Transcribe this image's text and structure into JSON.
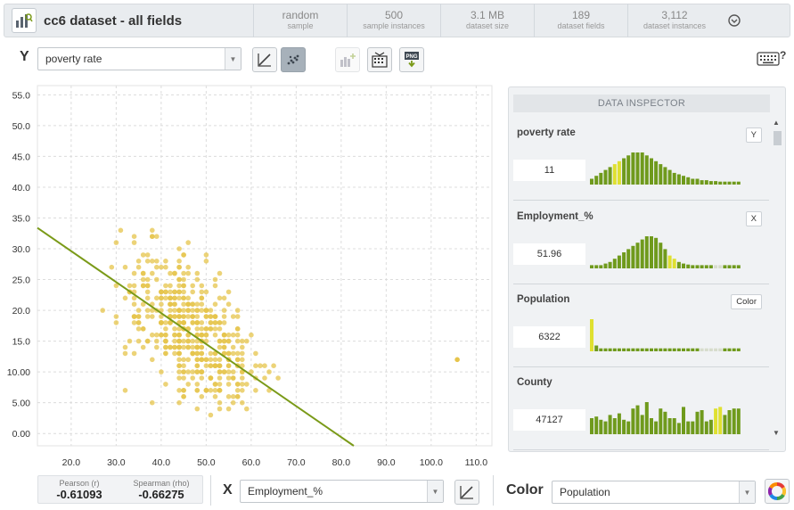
{
  "header": {
    "title": "cc6 dataset - all fields",
    "stats": [
      {
        "value": "random",
        "label": "sample"
      },
      {
        "value": "500",
        "label": "sample instances"
      },
      {
        "value": "3.1 MB",
        "label": "dataset size"
      },
      {
        "value": "189",
        "label": "dataset fields"
      },
      {
        "value": "3,112",
        "label": "dataset instances"
      }
    ]
  },
  "y_axis": {
    "letter": "Y",
    "selected": "poverty rate"
  },
  "x_axis": {
    "letter": "X",
    "selected": "Employment_%"
  },
  "color_axis": {
    "label": "Color",
    "selected": "Population"
  },
  "keyboard_help": "?",
  "correlation": {
    "pearson_label": "Pearson (r)",
    "pearson_value": "-0.61093",
    "spearman_label": "Spearman (rho)",
    "spearman_value": "-0.66275"
  },
  "inspector": {
    "title": "DATA INSPECTOR",
    "fields": [
      {
        "name": "poverty rate",
        "tag": "Y",
        "value": "11",
        "bars": [
          2,
          3,
          4,
          5,
          6,
          7,
          8,
          9,
          10,
          11,
          11,
          11,
          10,
          9,
          8,
          7,
          6,
          5,
          4,
          3.5,
          3,
          2.5,
          2,
          2,
          1.5,
          1.5,
          1.2,
          1.2,
          1,
          1,
          1,
          1,
          1
        ],
        "highlight": [
          5,
          6
        ],
        "faded": []
      },
      {
        "name": "Employment_%",
        "tag": "X",
        "value": "51.96",
        "bars": [
          1,
          1,
          1,
          1.5,
          2,
          3,
          4,
          5,
          6,
          7,
          8,
          9,
          10,
          10,
          9.5,
          8,
          6,
          4,
          3,
          2,
          1.5,
          1.2,
          1,
          1,
          1,
          1,
          1,
          1,
          1,
          1,
          1,
          1,
          1
        ],
        "highlight": [
          17,
          18
        ],
        "faded": [
          27,
          28
        ]
      },
      {
        "name": "Population",
        "tag": "Color",
        "value": "6322",
        "bars": [
          11,
          2,
          1,
          1,
          1,
          1,
          1,
          1,
          1,
          1,
          1,
          1,
          1,
          1,
          1,
          1,
          1,
          1,
          1,
          1,
          1,
          1,
          1,
          1,
          1,
          1,
          1,
          1,
          1,
          1,
          1,
          1,
          1
        ],
        "highlight": [
          0
        ],
        "faded": [
          24,
          25,
          26,
          27,
          28
        ]
      },
      {
        "name": "County",
        "tag": "",
        "value": "47127",
        "bars": [
          5,
          5.5,
          4.5,
          4,
          6,
          5,
          6.5,
          4.5,
          4,
          8,
          9,
          6,
          10,
          5,
          4,
          8,
          7,
          5,
          5,
          3.5,
          8.5,
          4,
          4,
          7,
          7.5,
          4,
          4.5,
          8,
          8.5,
          6,
          7.5,
          8,
          8
        ],
        "highlight": [
          27,
          28
        ],
        "faded": []
      }
    ]
  },
  "chart_data": {
    "type": "scatter",
    "x_ticks": [
      "20.0",
      "30.0",
      "40.0",
      "50.0",
      "60.0",
      "70.0",
      "80.0",
      "90.0",
      "100.0",
      "110.0"
    ],
    "y_ticks": [
      "0.00",
      "5.00",
      "10.00",
      "15.0",
      "20.0",
      "25.0",
      "30.0",
      "35.0",
      "40.0",
      "45.0",
      "50.0",
      "55.0"
    ],
    "xlim": [
      12.5,
      113.5
    ],
    "ylim": [
      -2,
      56.5
    ],
    "grid": true,
    "point_color": "#e6c44b",
    "trend_color": "#7a9a18",
    "trend_line": {
      "x": [
        12.5,
        82.8
      ],
      "y": [
        33.4,
        -2
      ]
    },
    "outliers": [
      {
        "x": 105.8,
        "y": 12.0
      }
    ],
    "cluster": {
      "n": 500,
      "x_center": 46.5,
      "y_center": 16.5,
      "x_spread": 7.5,
      "y_spread": 5.5,
      "slope": -0.45
    }
  }
}
